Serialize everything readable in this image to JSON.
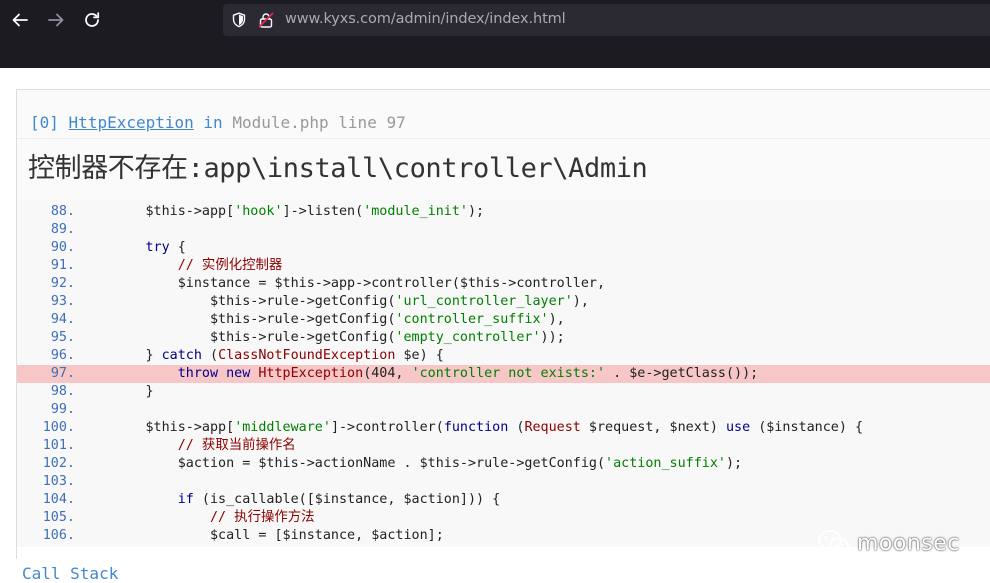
{
  "browser": {
    "url_host": "www.kyxs.com",
    "url_path": "/admin/index/index.html",
    "back_icon": "back-arrow-icon",
    "forward_icon": "forward-arrow-icon",
    "reload_icon": "reload-icon",
    "shield_icon": "shield-icon",
    "lock_icon": "insecure-lock-icon"
  },
  "exception": {
    "index": "[0]",
    "class_name": "HttpException",
    "in_word": "in",
    "location": "Module.php line 97",
    "message": "控制器不存在:app\\install\\controller\\Admin"
  },
  "code": {
    "highlight_line": "97.",
    "lines": [
      {
        "num": "88.",
        "src": "        $this->app['hook']->listen('module_init');"
      },
      {
        "num": "89.",
        "src": ""
      },
      {
        "num": "90.",
        "src": "        try {"
      },
      {
        "num": "91.",
        "src": "            // 实例化控制器"
      },
      {
        "num": "92.",
        "src": "            $instance = $this->app->controller($this->controller,"
      },
      {
        "num": "93.",
        "src": "                $this->rule->getConfig('url_controller_layer'),"
      },
      {
        "num": "94.",
        "src": "                $this->rule->getConfig('controller_suffix'),"
      },
      {
        "num": "95.",
        "src": "                $this->rule->getConfig('empty_controller'));"
      },
      {
        "num": "96.",
        "src": "        } catch (ClassNotFoundException $e) {"
      },
      {
        "num": "97.",
        "src": "            throw new HttpException(404, 'controller not exists:' . $e->getClass());"
      },
      {
        "num": "98.",
        "src": "        }"
      },
      {
        "num": "99.",
        "src": ""
      },
      {
        "num": "100.",
        "src": "        $this->app['middleware']->controller(function (Request $request, $next) use ($instance) {"
      },
      {
        "num": "101.",
        "src": "            // 获取当前操作名"
      },
      {
        "num": "102.",
        "src": "            $action = $this->actionName . $this->rule->getConfig('action_suffix');"
      },
      {
        "num": "103.",
        "src": ""
      },
      {
        "num": "104.",
        "src": "            if (is_callable([$instance, $action])) {"
      },
      {
        "num": "105.",
        "src": "                // 执行操作方法"
      },
      {
        "num": "106.",
        "src": "                $call = [$instance, $action];"
      }
    ]
  },
  "call_stack_label": "Call Stack",
  "watermark": {
    "text": "moonsec",
    "icon": "wechat-icon"
  },
  "colors": {
    "chrome_bg": "#1c1b22",
    "urlbar_bg": "#2b2a33",
    "link_blue": "#4288ce",
    "highlight_bg": "#f7c6c6",
    "keyword": "#00008b",
    "string": "#008000",
    "comment": "#8b0000"
  }
}
